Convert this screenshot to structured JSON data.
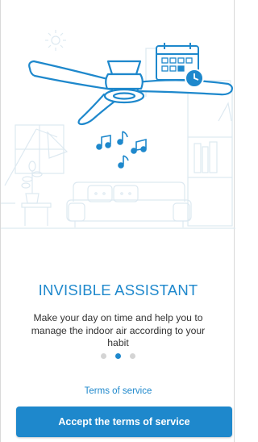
{
  "colors": {
    "accent": "#1e88cc",
    "line_art": "#dde9f1",
    "dot_inactive": "#d4d4d4",
    "dot_active": "#1e88cc"
  },
  "illustration": {
    "icons": [
      "sun-icon",
      "ceiling-fan-icon",
      "calendar-clock-icon",
      "music-notes-icon",
      "floor-lamp-icon",
      "plant-icon",
      "sofa-icon",
      "bookshelf-icon"
    ]
  },
  "onboarding": {
    "title": "INVISIBLE ASSISTANT",
    "subtitle": "Make your day on time and help you to manage the indoor air according to your habit",
    "pager": {
      "total": 3,
      "active_index": 1
    }
  },
  "footer": {
    "terms_link": "Terms of service",
    "accept_button": "Accept the terms of service"
  }
}
